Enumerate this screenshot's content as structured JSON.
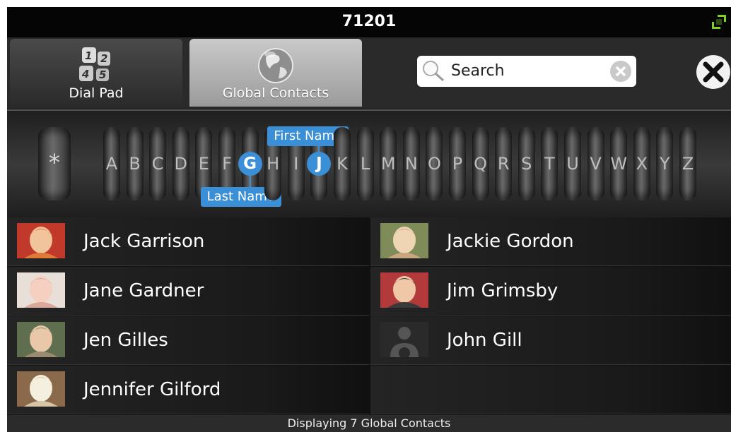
{
  "topbar": {
    "title": "71201"
  },
  "tabs": [
    {
      "label": "Dial Pad",
      "icon": "dialpad-icon",
      "active": false
    },
    {
      "label": "Global Contacts",
      "icon": "globe-icon",
      "active": true
    }
  ],
  "search": {
    "placeholder": "Search"
  },
  "alphabet": {
    "special": "*",
    "letters": [
      "A",
      "B",
      "C",
      "D",
      "E",
      "F",
      "G",
      "H",
      "I",
      "J",
      "K",
      "L",
      "M",
      "N",
      "O",
      "P",
      "Q",
      "R",
      "S",
      "T",
      "U",
      "V",
      "W",
      "X",
      "Y",
      "Z"
    ],
    "selected_first_name": "J",
    "selected_last_name": "G",
    "first_name_label": "First Name",
    "last_name_label": "Last Name"
  },
  "contacts": [
    {
      "name": "Jack Garrison",
      "avatar": "photo"
    },
    {
      "name": "Jackie Gordon",
      "avatar": "photo"
    },
    {
      "name": "Jane Gardner",
      "avatar": "photo"
    },
    {
      "name": "Jim Grimsby",
      "avatar": "photo"
    },
    {
      "name": "Jen Gilles",
      "avatar": "photo"
    },
    {
      "name": "John Gill",
      "avatar": "placeholder-person"
    },
    {
      "name": "Jennifer Gilford",
      "avatar": "photo"
    }
  ],
  "status": {
    "text": "Displaying 7 Global Contacts"
  },
  "colors": {
    "accent": "#3a8fd6",
    "expand_icon": "#7ed321"
  }
}
